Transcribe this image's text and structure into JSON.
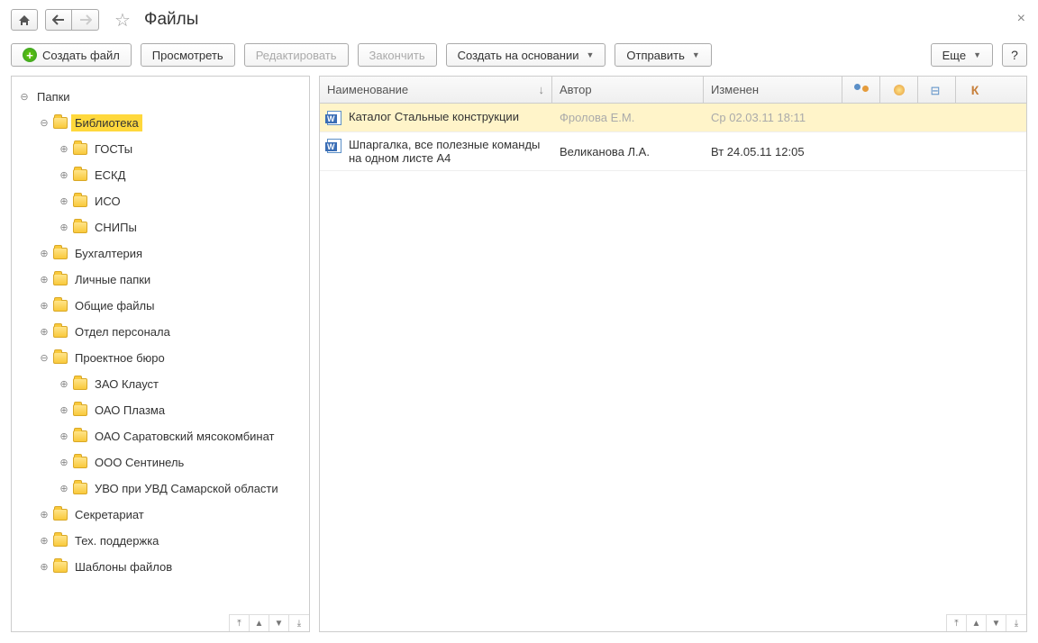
{
  "title": "Файлы",
  "toolbar": {
    "create": "Создать файл",
    "view": "Просмотреть",
    "edit": "Редактировать",
    "finish": "Закончить",
    "create_based": "Создать на основании",
    "send": "Отправить",
    "more": "Еще",
    "help": "?"
  },
  "tree_root": "Папки",
  "tree": {
    "biblioteka": "Библиотека",
    "gosty": "ГОСТы",
    "eskd": "ЕСКД",
    "iso": "ИСО",
    "snipy": "СНИПы",
    "buh": "Бухгалтерия",
    "personal_folders": "Личные папки",
    "shared": "Общие файлы",
    "hr": "Отдел персонала",
    "project": "Проектное бюро",
    "zao": "ЗАО Клауст",
    "plazma": "ОАО Плазма",
    "saratov": "ОАО Саратовский мясокомбинат",
    "sentinel": "ООО Сентинель",
    "uvo": "УВО при УВД Самарской области",
    "secretariat": "Секретариат",
    "support": "Тех. поддержка",
    "templates": "Шаблоны файлов"
  },
  "columns": {
    "name": "Наименование",
    "author": "Автор",
    "modified": "Изменен",
    "k": "К"
  },
  "rows": [
    {
      "name": "Каталог Стальные конструкции",
      "author": "Фролова Е.М.",
      "date": "Ср 02.03.11 18:11",
      "selected": true
    },
    {
      "name": "Шпаргалка, все полезные команды на одном листе А4",
      "author": "Великанова Л.А.",
      "date": "Вт 24.05.11 12:05",
      "selected": false
    }
  ]
}
